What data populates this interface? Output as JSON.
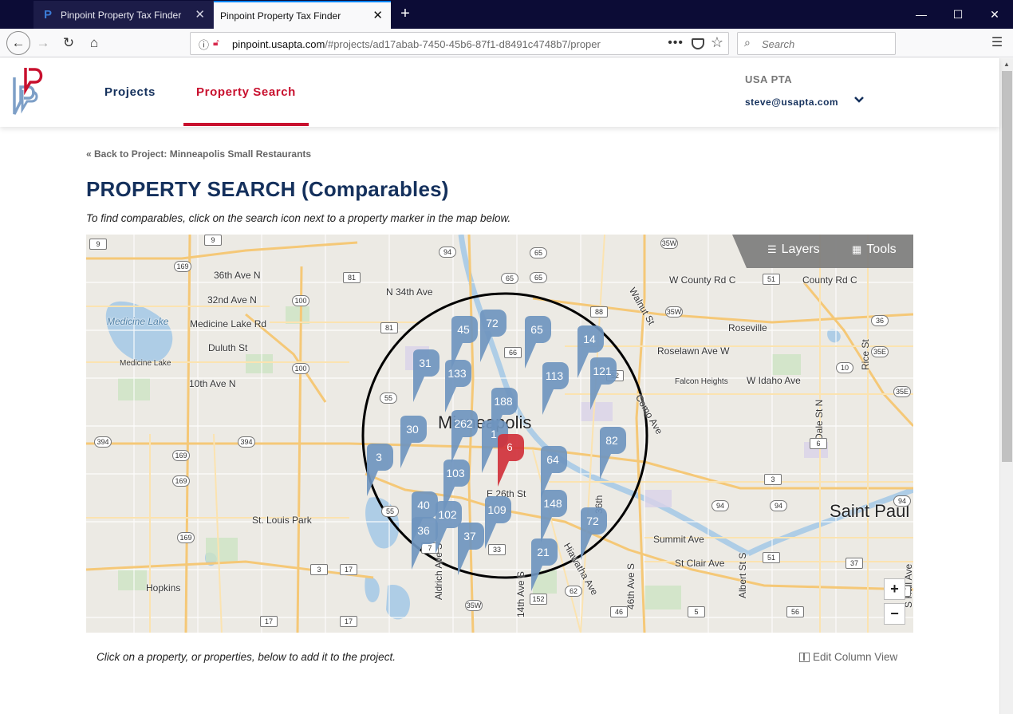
{
  "browser": {
    "tabs": [
      {
        "title": "Pinpoint Property Tax Finder",
        "favicon": "P"
      },
      {
        "title": "Pinpoint Property Tax Finder",
        "favicon": ""
      }
    ],
    "new_tab": "+",
    "window_controls": {
      "minimize": "—",
      "maximize": "☐",
      "close": "✕"
    },
    "url_host": "pinpoint.usapta.com",
    "url_path": "/#projects/ad17abab-7450-45b6-87f1-d8491c4748b7/proper",
    "page_actions": "•••",
    "search_placeholder": "Search",
    "menu": "☰"
  },
  "header": {
    "nav": {
      "projects": "Projects",
      "property_search": "Property Search"
    },
    "org": "USA PTA",
    "user_email": "steve@usapta.com",
    "user_chevron": "⌄"
  },
  "content": {
    "back_link": "« Back to Project: Minneapolis Small Restaurants",
    "title": "PROPERTY SEARCH (Comparables)",
    "instructions": "To find comparables, click on the search icon next to a property marker in the map below.",
    "footer_hint": "Click on a property, or properties, below to add it to the project.",
    "edit_column_view": "Edit Column View"
  },
  "map": {
    "controls": {
      "layers": "Layers",
      "tools": "Tools",
      "zoom_in": "+",
      "zoom_out": "−"
    },
    "labels": {
      "w36": "36th Ave N",
      "w32": "32nd Ave N",
      "n34": "N 34th Ave",
      "medicine_lake_water": "Medicine Lake",
      "medicine_lake_rd": "Medicine Lake Rd",
      "duluth": "Duluth St",
      "medicine_lake_city": "Medicine Lake",
      "tenth": "10th Ave N",
      "minneapolis": "Minneapolis",
      "e26": "E 26th St",
      "st_louis_park": "St. Louis Park",
      "hopkins": "Hopkins",
      "aldrich": "Aldrich Ave S",
      "fourteenth": "14th Ave S",
      "hiawatha": "Hiawatha Ave",
      "thirtysixth": "36th",
      "fortysixth": "46th Ave S",
      "walnut": "Walnut St",
      "county_rd_c_w": "W County Rd C",
      "county_rd_c": "County Rd C",
      "roseville": "Roseville",
      "roselawn": "Roselawn Ave W",
      "rice": "Rice St",
      "falcon": "Falcon Heights",
      "idaho": "W Idaho Ave",
      "como": "Como Ave",
      "dale": "Dale St N",
      "saint_paul": "Saint Paul",
      "summit": "Summit Ave",
      "st_clair": "St Clair Ave",
      "albert": "Albert St S",
      "hall": "S Hall Ave"
    },
    "shields": [
      "9",
      "9",
      "169",
      "94",
      "65",
      "65",
      "81",
      "100",
      "81",
      "100",
      "55",
      "394",
      "394",
      "169",
      "169",
      "35W",
      "35W",
      "88",
      "51",
      "36",
      "35E",
      "66",
      "52",
      "6",
      "94",
      "94",
      "94",
      "37",
      "3",
      "7",
      "17",
      "17",
      "33",
      "35W",
      "152",
      "46",
      "51",
      "56",
      "5",
      "169",
      "17",
      "55",
      "10",
      "35E",
      "37",
      "3",
      "62",
      "65"
    ],
    "markers": [
      {
        "count": "45",
        "color": "#6f95bf"
      },
      {
        "count": "72",
        "color": "#6f95bf"
      },
      {
        "count": "65",
        "color": "#6f95bf"
      },
      {
        "count": "14",
        "color": "#6f95bf"
      },
      {
        "count": "31",
        "color": "#6f95bf"
      },
      {
        "count": "133",
        "color": "#6f95bf"
      },
      {
        "count": "113",
        "color": "#6f95bf"
      },
      {
        "count": "121",
        "color": "#6f95bf"
      },
      {
        "count": "188",
        "color": "#6f95bf"
      },
      {
        "count": "30",
        "color": "#6f95bf"
      },
      {
        "count": "262",
        "color": "#6f95bf"
      },
      {
        "count": "1",
        "color": "#6f95bf"
      },
      {
        "count": "82",
        "color": "#6f95bf"
      },
      {
        "count": "3",
        "color": "#6f95bf"
      },
      {
        "count": "6",
        "color": "#d0313b"
      },
      {
        "count": "64",
        "color": "#6f95bf"
      },
      {
        "count": "103",
        "color": "#6f95bf"
      },
      {
        "count": "40",
        "color": "#6f95bf"
      },
      {
        "count": "102",
        "color": "#6f95bf"
      },
      {
        "count": "109",
        "color": "#6f95bf"
      },
      {
        "count": "148",
        "color": "#6f95bf"
      },
      {
        "count": "36",
        "color": "#6f95bf"
      },
      {
        "count": "37",
        "color": "#6f95bf"
      },
      {
        "count": "72",
        "color": "#6f95bf"
      },
      {
        "count": "21",
        "color": "#6f95bf"
      }
    ]
  },
  "colors": {
    "navy": "#14305c",
    "brand_red": "#c8102e",
    "marker_blue": "#6f95bf",
    "marker_red": "#d0313b"
  }
}
